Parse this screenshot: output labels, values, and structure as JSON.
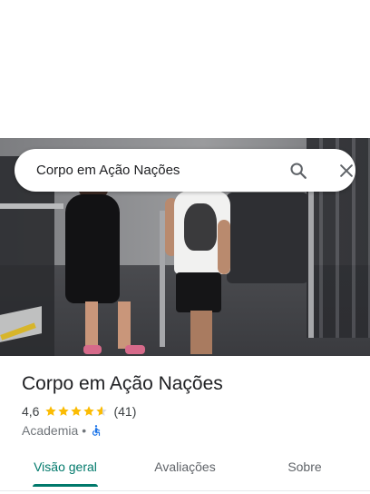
{
  "search": {
    "query": "Corpo em Ação Nações",
    "search_icon": "search-icon",
    "close_icon": "close-icon"
  },
  "hero": {
    "image_icon": "place-photo"
  },
  "place": {
    "name": "Corpo em Ação Nações",
    "rating": "4,6",
    "rating_value": 4.6,
    "rating_max": 5,
    "reviews_count": "(41)",
    "category": "Academia",
    "separator": "•",
    "accessibility_icon": "wheelchair-accessible-icon"
  },
  "tabs": {
    "overview": "Visão geral",
    "reviews": "Avaliações",
    "about": "Sobre",
    "active": "overview"
  },
  "colors": {
    "accent": "#00796b",
    "star": "#fbbc04",
    "accessibility": "#1a73e8",
    "text_primary": "#202124",
    "text_secondary": "#70757a"
  }
}
